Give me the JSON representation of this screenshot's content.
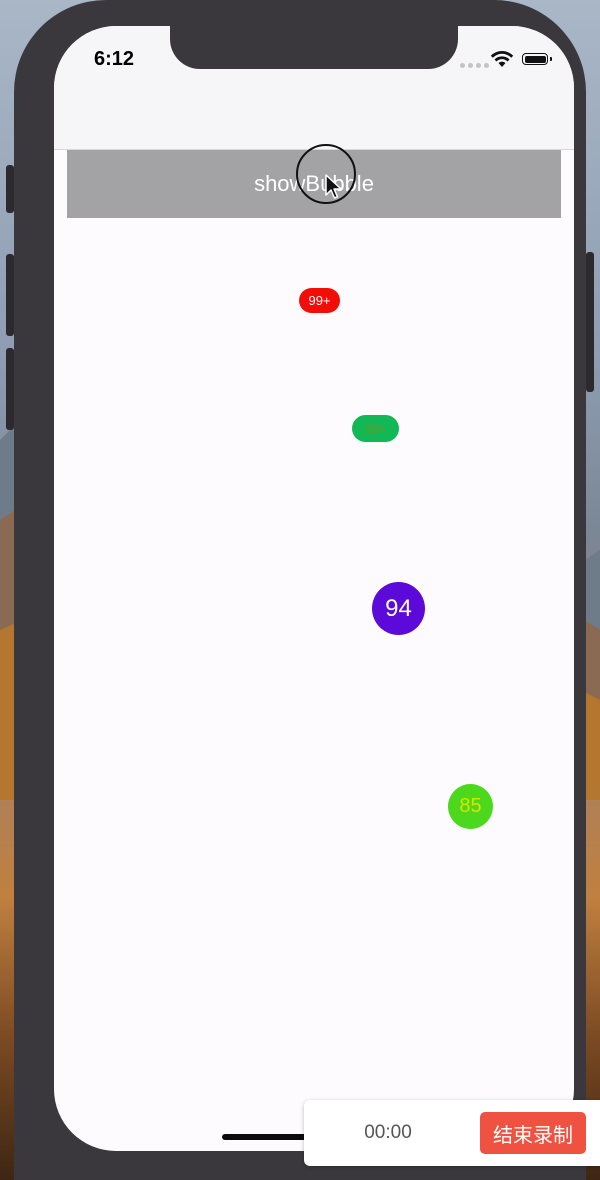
{
  "status_bar": {
    "time": "6:12"
  },
  "main": {
    "show_bubble_label": "showBubble",
    "bubbles": [
      {
        "text": "99+",
        "bg": "#f20d07",
        "fg": "#ffffff"
      },
      {
        "text": "99+",
        "bg": "#12b855",
        "fg": "#7d8f1f"
      },
      {
        "text": "94",
        "bg": "#5b0ad9",
        "fg": "#ffffff"
      },
      {
        "text": "85",
        "bg": "#4cd91d",
        "fg": "#d9e200"
      }
    ]
  },
  "recorder": {
    "elapsed": "00:00",
    "stop_label": "结束录制",
    "accent": "#f05242"
  },
  "icons": [
    "wifi-icon",
    "battery-icon",
    "signal-dots-icon",
    "pointer-cursor-icon"
  ]
}
